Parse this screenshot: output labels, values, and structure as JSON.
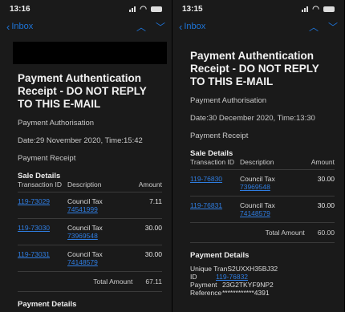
{
  "left": {
    "time": "13:16",
    "nav": {
      "back_label": "Inbox"
    },
    "subject": "Payment Authentication Receipt - DO NOT REPLY TO THIS E-MAIL",
    "auth_label": "Payment Authorisation",
    "date_line": "Date:29 November 2020, Time:15:42",
    "receipt_label": "Payment Receipt",
    "sale_details_title": "Sale Details",
    "columns": {
      "id": "Transaction ID",
      "desc": "Description",
      "amount": "Amount"
    },
    "rows": [
      {
        "id": "119-73029",
        "desc": "Council Tax",
        "ref": "74541999",
        "amount": "7.11"
      },
      {
        "id": "119-73030",
        "desc": "Council Tax",
        "ref": "73969548",
        "amount": "30.00"
      },
      {
        "id": "119-73031",
        "desc": "Council Tax",
        "ref": "74148579",
        "amount": "30.00"
      }
    ],
    "total_label": "Total Amount",
    "total_value": "67.11",
    "payment_details_title": "Payment Details"
  },
  "right": {
    "time": "13:15",
    "nav": {
      "back_label": "Inbox"
    },
    "subject": "Payment Authentication Receipt - DO NOT REPLY TO THIS E-MAIL",
    "auth_label": "Payment Authorisation",
    "date_line": "Date:30 December 2020, Time:13:30",
    "receipt_label": "Payment Receipt",
    "sale_details_title": "Sale Details",
    "columns": {
      "id": "Transaction ID",
      "desc": "Description",
      "amount": "Amount"
    },
    "rows": [
      {
        "id": "119-76830",
        "desc": "Council Tax",
        "ref": "73969548",
        "amount": "30.00"
      },
      {
        "id": "119-76831",
        "desc": "Council Tax",
        "ref": "74148579",
        "amount": "30.00"
      }
    ],
    "total_label": "Total Amount",
    "total_value": "60.00",
    "payment_details_title": "Payment Details",
    "payment_details": [
      {
        "key": "Unique Tran",
        "value": "S2UXXH35BJ32"
      },
      {
        "key": "ID",
        "value": "119-76832"
      },
      {
        "key": "Payment",
        "value": "23G2TKYF9NP2"
      },
      {
        "key": "Reference",
        "value": "************4391"
      }
    ]
  }
}
